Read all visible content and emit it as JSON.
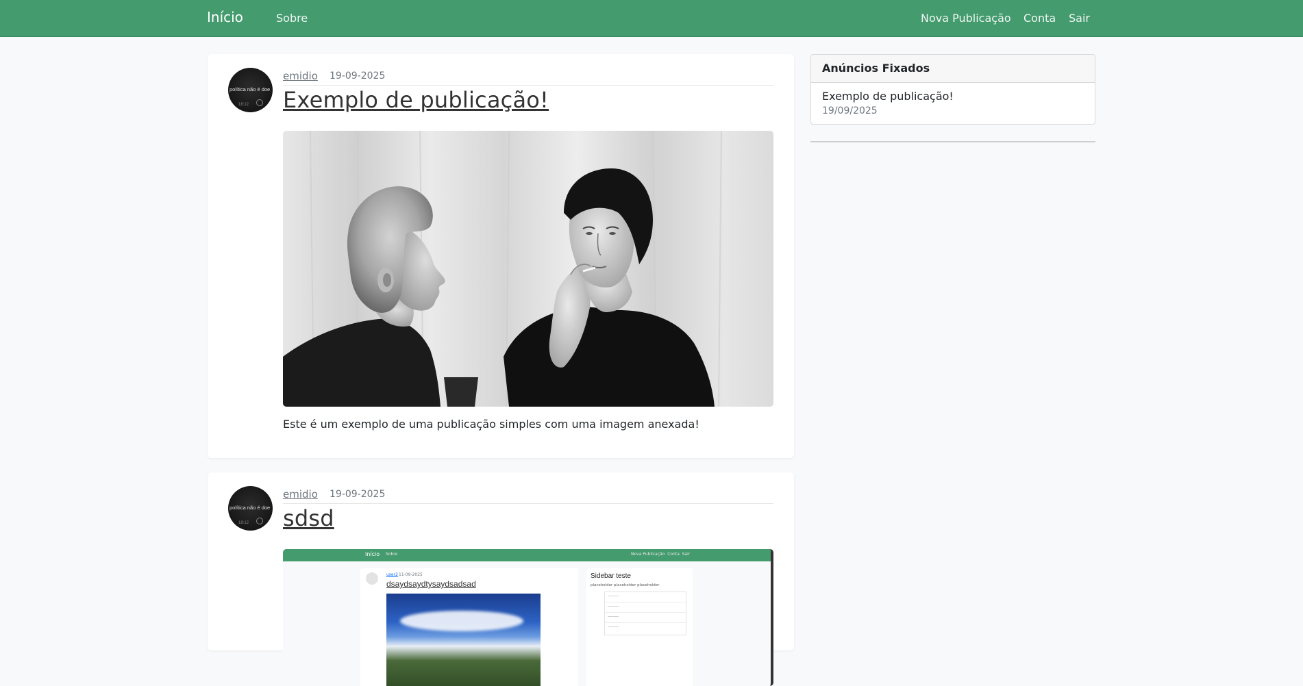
{
  "navbar": {
    "brand": "Início",
    "about": "Sobre",
    "new_post": "Nova Publicação",
    "account": "Conta",
    "logout": "Sair",
    "color": "#439b6e"
  },
  "posts": [
    {
      "author": "emidio",
      "date": "19-09-2025",
      "title": "Exemplo de publicação!",
      "avatar_text": "política não é doe",
      "avatar_time": "18:12",
      "image": "black-and-white-photo-two-women",
      "content": "Este é um exemplo de uma publicação simples com uma imagem anexada!"
    },
    {
      "author": "emidio",
      "date": "19-09-2025",
      "title": "sdsd",
      "avatar_text": "política não é doe",
      "avatar_time": "18:12",
      "image": "screenshot-of-blog-page",
      "screenshot": {
        "brand": "Início",
        "about": "Sobre",
        "nav_right": "Nova Publicação  Conta  Sair",
        "author": "user2",
        "date": "11-09-2025",
        "title": "dsaydsaydtysaydsadsad",
        "sidebar_title": "Sidebar teste",
        "sidebar_text": "placeholder placeholder placeholder",
        "sidebar_lines": "---------"
      }
    }
  ],
  "sidebar": {
    "heading": "Anúncios Fixados",
    "items": [
      {
        "title": "Exemplo de publicação!",
        "date": "19/09/2025"
      }
    ]
  }
}
